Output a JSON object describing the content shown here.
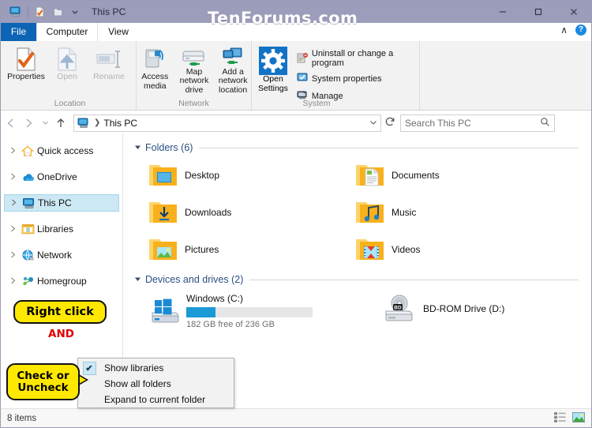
{
  "window": {
    "title": "This PC",
    "watermark": "TenForums.com",
    "minimize_label": "—",
    "maximize_label": "❐",
    "close_label": "✕",
    "quick_access_icons": [
      "this-pc-icon",
      "properties-icon",
      "new-folder-icon",
      "customize-qat-dropdown"
    ]
  },
  "ribbon": {
    "tabs": [
      {
        "label": "File",
        "id": "file"
      },
      {
        "label": "Computer",
        "id": "computer"
      },
      {
        "label": "View",
        "id": "view"
      }
    ],
    "active_tab": "Computer",
    "collapse_label": "∧",
    "help_label": "?",
    "groups": [
      {
        "name": "Location",
        "buttons": [
          {
            "label": "Properties",
            "enabled": true,
            "icon": "properties-icon"
          },
          {
            "label": "Open",
            "enabled": false,
            "icon": "open-icon"
          },
          {
            "label": "Rename",
            "enabled": false,
            "icon": "rename-icon"
          }
        ]
      },
      {
        "name": "Network",
        "buttons": [
          {
            "label": "Access media",
            "enabled": true,
            "icon": "access-media-icon",
            "dropdown": true
          },
          {
            "label": "Map network drive",
            "enabled": true,
            "icon": "map-network-drive-icon",
            "dropdown": true
          },
          {
            "label": "Add a network location",
            "enabled": true,
            "icon": "add-network-location-icon",
            "dropdown": false
          }
        ]
      },
      {
        "name": "System",
        "open_settings": {
          "label_line1": "Open",
          "label_line2": "Settings",
          "icon": "gear-icon"
        },
        "items": [
          {
            "label": "Uninstall or change a program",
            "icon": "uninstall-program-icon"
          },
          {
            "label": "System properties",
            "icon": "system-properties-icon"
          },
          {
            "label": "Manage",
            "icon": "manage-icon"
          }
        ]
      }
    ]
  },
  "addressbar": {
    "back_label": "←",
    "forward_label": "→",
    "recent_label": "⌵",
    "up_label": "↑",
    "path_icon": "this-pc-icon",
    "path_separator": "❯",
    "path_text": "This PC",
    "dropdown_label": "⌵",
    "refresh_label": "↻",
    "search_placeholder": "Search This PC",
    "search_value": "",
    "search_icon": "search-icon"
  },
  "navpane": {
    "items": [
      {
        "label": "Quick access",
        "icon": "quick-access-icon",
        "selected": false
      },
      {
        "label": "OneDrive",
        "icon": "onedrive-cloud-icon",
        "selected": false
      },
      {
        "label": "This PC",
        "icon": "this-pc-icon",
        "selected": true
      },
      {
        "label": "Libraries",
        "icon": "libraries-icon",
        "selected": false
      },
      {
        "label": "Network",
        "icon": "network-globe-icon",
        "selected": false
      },
      {
        "label": "Homegroup",
        "icon": "homegroup-icon",
        "selected": false
      }
    ],
    "expander_glyph": "▷"
  },
  "content": {
    "groups": [
      {
        "title": "Folders (6)",
        "collapse_glyph": "◢",
        "items": [
          {
            "label": "Desktop",
            "icon": "folder-desktop-icon"
          },
          {
            "label": "Documents",
            "icon": "folder-documents-icon"
          },
          {
            "label": "Downloads",
            "icon": "folder-downloads-icon"
          },
          {
            "label": "Music",
            "icon": "folder-music-icon"
          },
          {
            "label": "Pictures",
            "icon": "folder-pictures-icon"
          },
          {
            "label": "Videos",
            "icon": "folder-videos-icon"
          }
        ]
      },
      {
        "title": "Devices and drives (2)",
        "collapse_glyph": "◢",
        "drives": [
          {
            "label": "Windows (C:)",
            "icon": "windows-drive-icon",
            "capacity_text": "182 GB free of 236 GB",
            "used_percent": 23,
            "bar_color": "#1b9ad6"
          },
          {
            "label": "BD-ROM Drive (D:)",
            "icon": "bd-rom-drive-icon",
            "capacity_text": "",
            "used_percent": 0
          }
        ]
      }
    ]
  },
  "contextmenu": {
    "items": [
      {
        "label": "Show libraries",
        "checked": true,
        "check_glyph": "✔"
      },
      {
        "label": "Show all folders",
        "checked": false,
        "check_glyph": ""
      },
      {
        "label": "Expand to current folder",
        "checked": false,
        "check_glyph": ""
      }
    ]
  },
  "annotations": {
    "right_click": "Right click",
    "and": "AND",
    "check_or_uncheck_line1": "Check or",
    "check_or_uncheck_line2": "Uncheck",
    "colors": {
      "callout_fill": "#ffe800",
      "callout_border": "#111111",
      "and_text": "#e00000"
    }
  },
  "statusbar": {
    "item_count": "8 items",
    "details_view_icon": "details-view-icon",
    "large_icons_view_icon": "large-icons-view-icon"
  }
}
